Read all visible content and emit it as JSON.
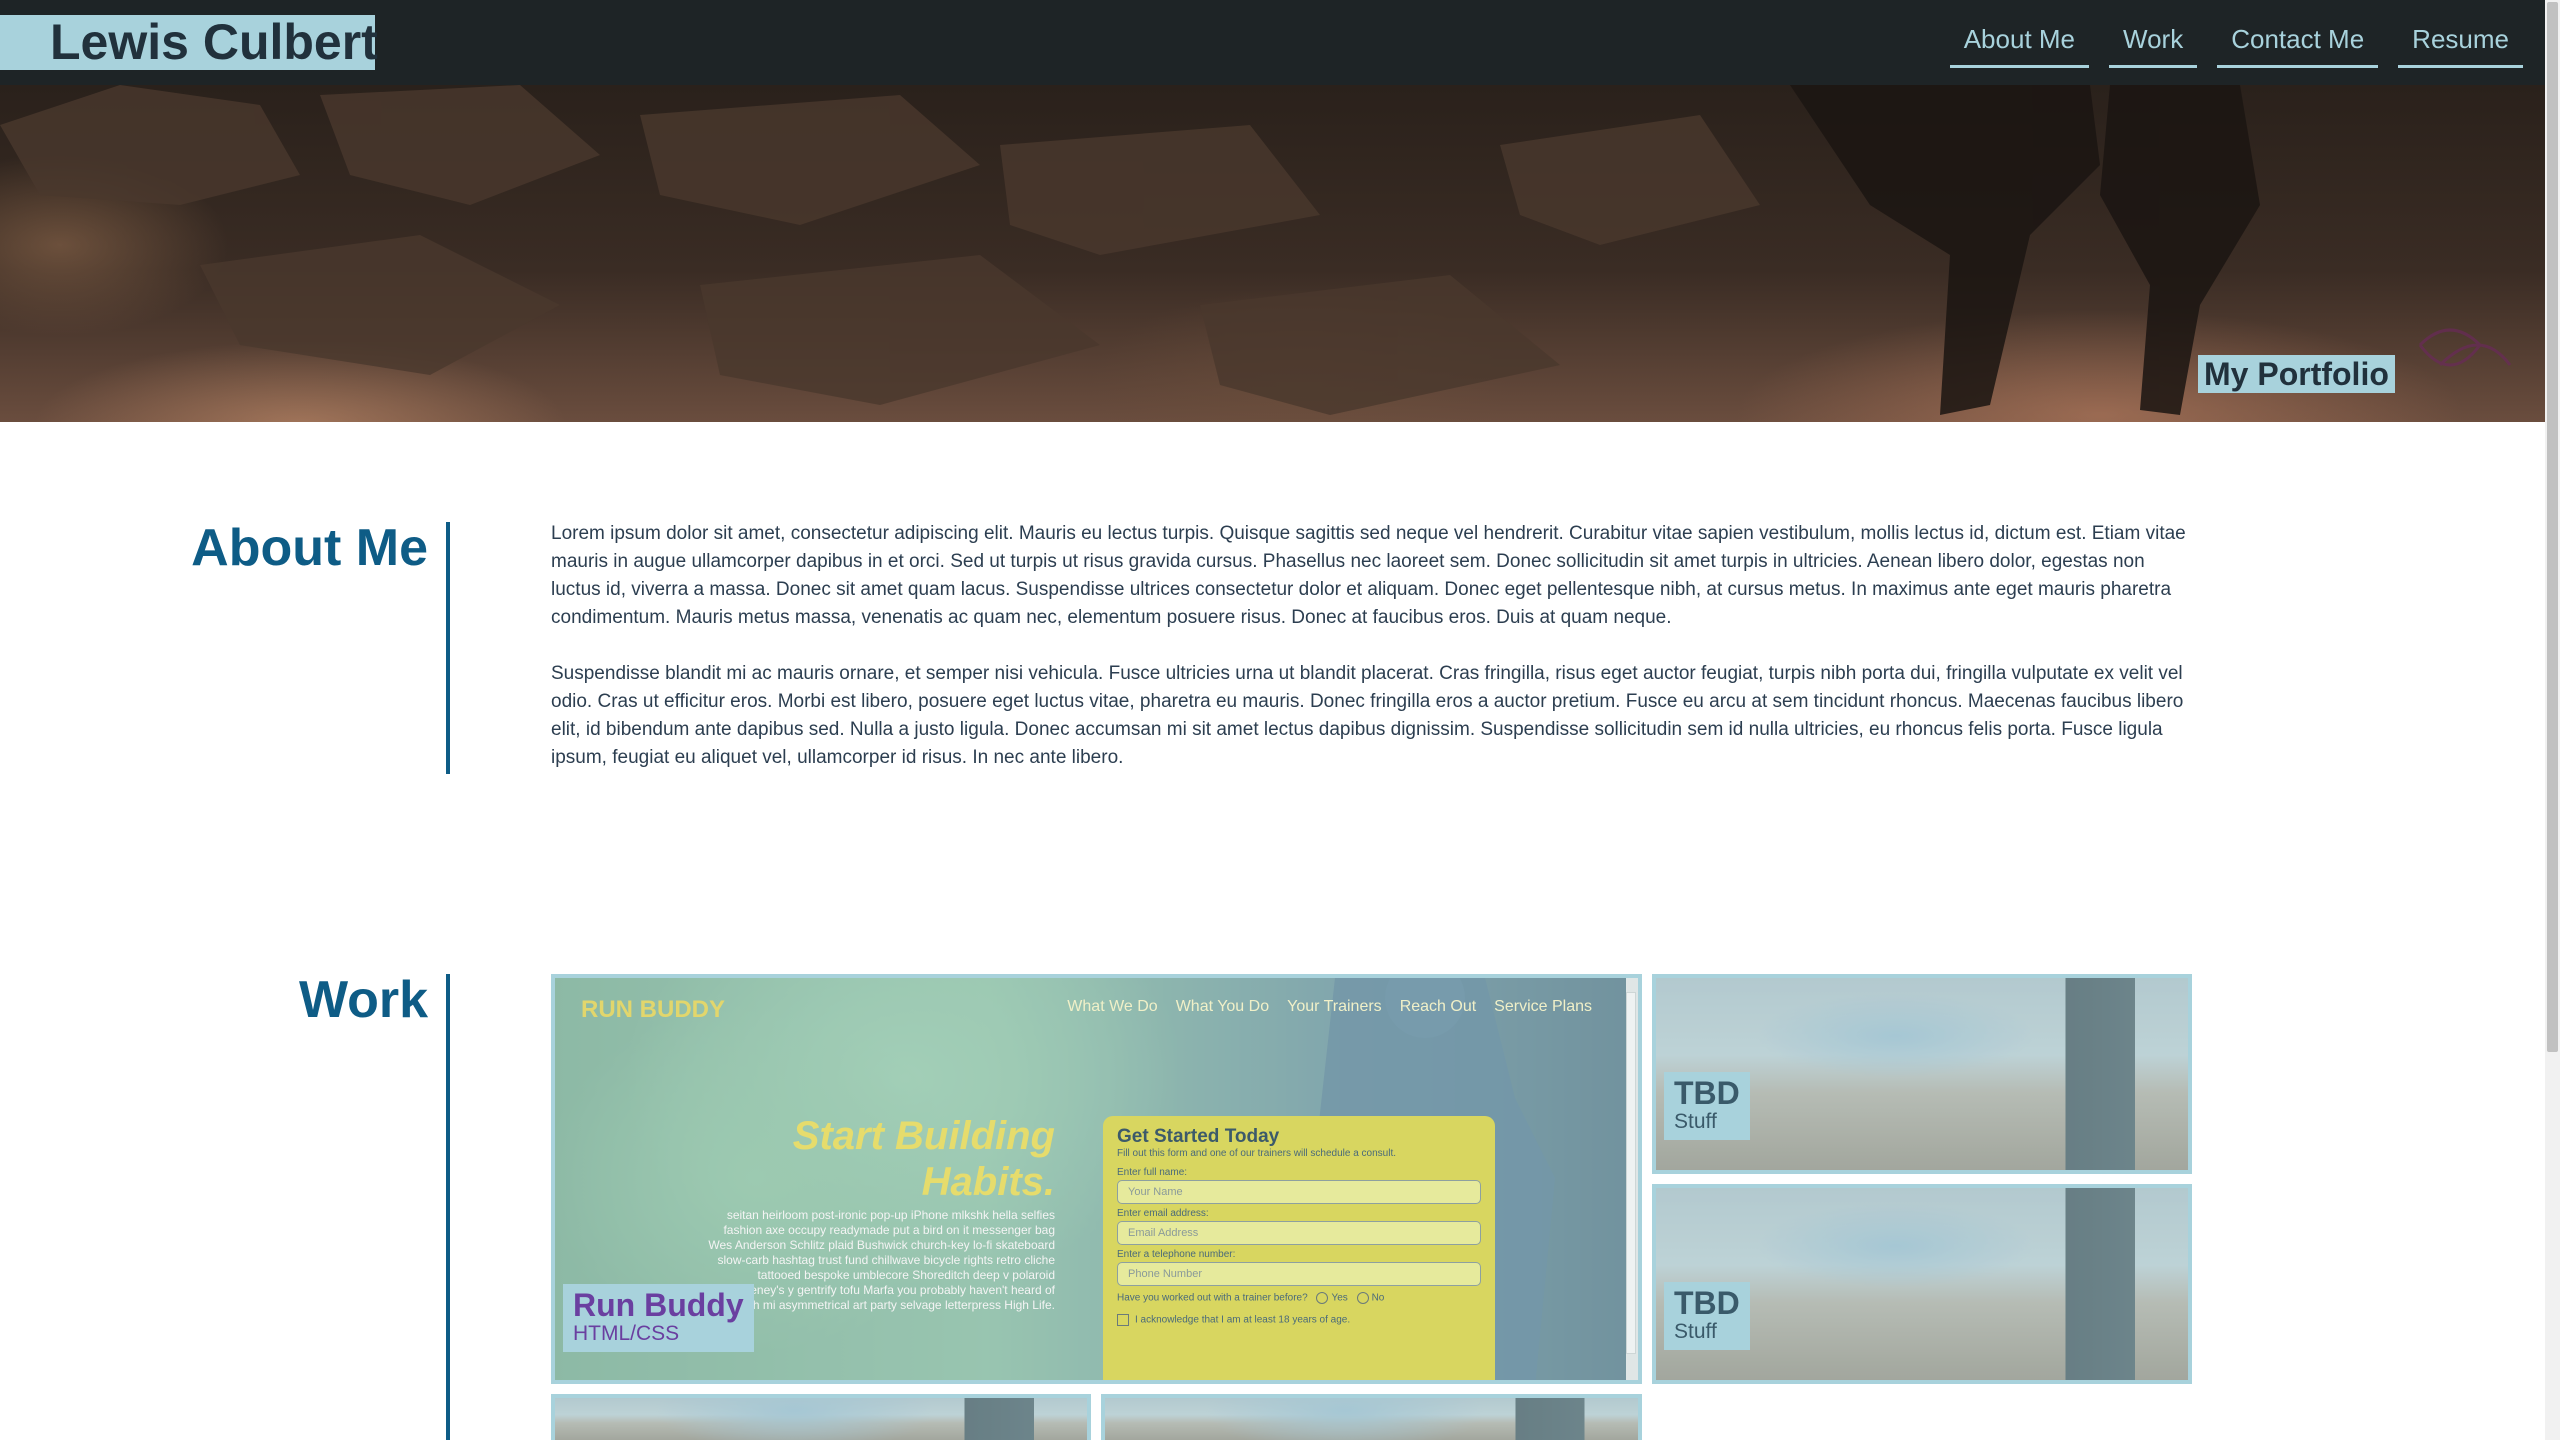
{
  "header": {
    "logo": "Lewis Culbert",
    "nav": [
      "About Me",
      "Work",
      "Contact Me",
      "Resume"
    ]
  },
  "hero": {
    "tag": "My Portfolio"
  },
  "about": {
    "title": "About Me",
    "paragraphs": [
      "Lorem ipsum dolor sit amet, consectetur adipiscing elit. Mauris eu lectus turpis. Quisque sagittis sed neque vel hendrerit. Curabitur vitae sapien vestibulum, mollis lectus id, dictum est. Etiam vitae mauris in augue ullamcorper dapibus in et orci. Sed ut turpis ut risus gravida cursus. Phasellus nec laoreet sem. Donec sollicitudin sit amet turpis in ultricies. Aenean libero dolor, egestas non luctus id, viverra a massa. Donec sit amet quam lacus. Suspendisse ultrices consectetur dolor et aliquam. Donec eget pellentesque nibh, at cursus metus. In maximus ante eget mauris pharetra condimentum. Mauris metus massa, venenatis ac quam nec, elementum posuere risus. Donec at faucibus eros. Duis at quam neque.",
      "Suspendisse blandit mi ac mauris ornare, et semper nisi vehicula. Fusce ultricies urna ut blandit placerat. Cras fringilla, risus eget auctor feugiat, turpis nibh porta dui, fringilla vulputate ex velit vel odio. Cras ut efficitur eros. Morbi est libero, posuere eget luctus vitae, pharetra eu mauris. Donec fringilla eros a auctor pretium. Fusce eu arcu at sem tincidunt rhoncus. Maecenas faucibus libero elit, id bibendum ante dapibus sed. Nulla a justo ligula. Donec accumsan mi sit amet lectus dapibus dignissim. Suspendisse sollicitudin sem id nulla ultricies, eu rhoncus felis porta. Fusce ligula ipsum, feugiat eu aliquet vel, ullamcorper id risus. In nec ante libero."
    ]
  },
  "work": {
    "title": "Work",
    "featured": {
      "title": "Run Buddy",
      "subtitle": "HTML/CSS",
      "preview": {
        "logo": "RUN BUDDY",
        "nav": [
          "What We Do",
          "What You Do",
          "Your Trainers",
          "Reach Out",
          "Service Plans"
        ],
        "headline_1": "Start Building",
        "headline_2": "Habits.",
        "copy": "seitan heirloom post-ironic pop-up iPhone mlkshk hella selfies fashion axe occupy readymade put a bird on it messenger bag Wes Anderson Schlitz plaid Bushwick church-key lo-fi skateboard slow-carb hashtag trust fund chillwave bicycle rights retro cliche tattooed bespoke umblecore Shoreditch deep v polaroid McSweeney's y gentrify tofu Marfa you probably haven't heard of banh mi asymmetrical art party selvage letterpress High Life.",
        "form_title": "Get Started Today",
        "form_sub": "Fill out this form and one of our trainers will schedule a consult.",
        "name_label": "Enter full name:",
        "name_placeholder": "Your Name",
        "email_label": "Enter email address:",
        "email_placeholder": "Email Address",
        "phone_label": "Enter a telephone number:",
        "phone_placeholder": "Phone Number",
        "question": "Have you worked out with a trainer before?",
        "yes": "Yes",
        "no": "No",
        "ack": "I acknowledge that I am at least 18 years of age."
      }
    },
    "tbd_title": "TBD",
    "tbd_sub": "Stuff"
  },
  "colors": {
    "accent": "#a8d2dc",
    "heading": "#0e5c86",
    "header_bg": "#1e2426"
  }
}
